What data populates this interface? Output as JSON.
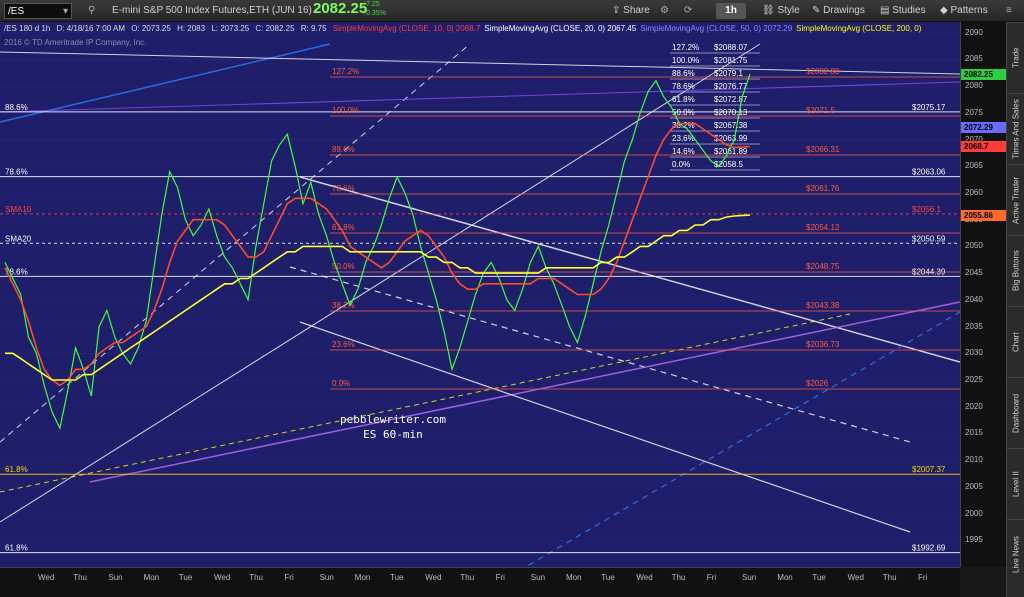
{
  "toolbar": {
    "symbol": "/ES",
    "title": "E-mini S&P 500 Index Futures,ETH (JUN 16)",
    "price": "2082.25",
    "change": "+7.25",
    "change_pct": "+0.35%",
    "share_label": "Share",
    "timeframe": "1h",
    "style_label": "Style",
    "drawings_label": "Drawings",
    "studies_label": "Studies",
    "patterns_label": "Patterns"
  },
  "ohlc": {
    "symbol": "/ES 180 d 1h",
    "date": "D: 4/18/16 7:00 AM",
    "open": "O: 2073.25",
    "high": "H: 2083",
    "low": "L: 2073.25",
    "close": "C: 2082.25",
    "range": "R: 9.75"
  },
  "studies": [
    {
      "label": "SimpleMovingAvg (CLOSE, 10, 0)",
      "value": "2068.7",
      "color": "#ff3b3b"
    },
    {
      "label": "SimpleMovingAvg (CLOSE, 20, 0)",
      "value": "2067.45",
      "color": "#ffffff"
    },
    {
      "label": "SimpleMovingAvg (CLOSE, 50, 0)",
      "value": "2072.29",
      "color": "#8a8aff"
    },
    {
      "label": "SimpleMovingAvg (CLOSE, 200, 0)",
      "value": "",
      "color": "#ffff00"
    }
  ],
  "copyright": "2016 © TD Ameritrade IP Company, Inc.",
  "watermark": {
    "line1": "pebblewriter.com",
    "line2": "ES 60-min"
  },
  "sidebar_tabs": [
    "Trade",
    "Times And Sales",
    "Active Trader",
    "Big Buttons",
    "Chart",
    "Dashboard",
    "Level II",
    "Live News"
  ],
  "price_flags": [
    {
      "value": "2082.25",
      "price": 2082.25,
      "bg": "#2ecc40",
      "fg": "#000000"
    },
    {
      "value": "2072.29",
      "price": 2072.29,
      "bg": "#6a6aff",
      "fg": "#000000"
    },
    {
      "value": "2068.7",
      "price": 2068.7,
      "bg": "#ff3b3b",
      "fg": "#000000"
    },
    {
      "value": "2055.86",
      "price": 2055.86,
      "bg": "#ff6a2a",
      "fg": "#000000"
    }
  ],
  "chart_data": {
    "type": "line",
    "title": "",
    "xlabel": "",
    "ylabel": "",
    "ylim": [
      1990,
      2092
    ],
    "yticks": [
      1995,
      2000,
      2005,
      2010,
      2015,
      2020,
      2025,
      2030,
      2035,
      2040,
      2045,
      2050,
      2055,
      2060,
      2065,
      2070,
      2075,
      2080,
      2085,
      2090
    ],
    "xticks": [
      "Wed",
      "Thu",
      "Sun",
      "Mon",
      "Tue",
      "Wed",
      "Thu",
      "Fri",
      "Sun",
      "Mon",
      "Tue",
      "Wed",
      "Thu",
      "Fri",
      "Sun",
      "Mon",
      "Tue",
      "Wed",
      "Thu",
      "Fri",
      "Sun",
      "Mon",
      "Tue",
      "Wed",
      "Thu",
      "Fri"
    ],
    "fib_levels_recent": [
      {
        "label": "127.2%",
        "value": "$2088.07"
      },
      {
        "label": "100.0%",
        "value": "$2081.75"
      },
      {
        "label": "88.6%",
        "value": "$2079.1"
      },
      {
        "label": "78.6%",
        "value": "$2076.77"
      },
      {
        "label": "61.8%",
        "value": "$2072.87"
      },
      {
        "label": "50.0%",
        "value": "$2070.13"
      },
      {
        "label": "38.2%",
        "value": "$2067.38"
      },
      {
        "label": "23.6%",
        "value": "$2063.99"
      },
      {
        "label": "14.6%",
        "value": "$2061.89"
      },
      {
        "label": "0.0%",
        "value": "$2058.5"
      }
    ],
    "fib_levels_prior": [
      {
        "label": "127.2%",
        "value": "$2082.88"
      },
      {
        "label": "100.0%",
        "value": "$2071.5"
      },
      {
        "label": "88.6%",
        "value": "$2066.31"
      },
      {
        "label": "78.6%",
        "value": "$2061.76"
      },
      {
        "label": "61.8%",
        "value": "$2054.12"
      },
      {
        "label": "50.0%",
        "value": "$2048.75"
      },
      {
        "label": "38.2%",
        "value": "$2043.38"
      },
      {
        "label": "23.6%",
        "value": "$2036.73"
      },
      {
        "label": "0.0%",
        "value": "$2026"
      }
    ],
    "horizontal_levels": [
      {
        "label": "88.6%",
        "value": "$2075.17",
        "price": 2075.17
      },
      {
        "label": "78.6%",
        "value": "$2063.06",
        "price": 2063.06
      },
      {
        "label": "SMA10",
        "value": "$2056.1",
        "price": 2056.1
      },
      {
        "label": "SMA20",
        "value": "$2050.59",
        "price": 2050.59
      },
      {
        "label": "78.6%",
        "value": "$2044.39",
        "price": 2044.39
      },
      {
        "label": "61.8%",
        "value": "$2007.37",
        "price": 2007.37
      },
      {
        "label": "61.8%",
        "value": "$1992.69",
        "price": 1992.69
      }
    ],
    "series": [
      {
        "name": "/ES",
        "values": [
          2047,
          2044,
          2041,
          2033,
          2030,
          2024,
          2019,
          2016,
          2023,
          2031,
          2027,
          2022,
          2035,
          2038,
          2033,
          2030,
          2028,
          2031,
          2036,
          2046,
          2056,
          2064,
          2061,
          2055,
          2052,
          2054,
          2057,
          2052,
          2048,
          2046,
          2043,
          2040,
          2050,
          2058,
          2066,
          2069,
          2071,
          2065,
          2058,
          2062,
          2056,
          2052,
          2047,
          2043,
          2039,
          2042,
          2047,
          2050,
          2054,
          2059,
          2063,
          2060,
          2056,
          2050,
          2045,
          2040,
          2034,
          2027,
          2031,
          2036,
          2041,
          2045,
          2047,
          2044,
          2040,
          2038,
          2042,
          2047,
          2050,
          2046,
          2043,
          2039,
          2035,
          2032,
          2037,
          2043,
          2049,
          2054,
          2060,
          2066,
          2070,
          2075,
          2079,
          2081,
          2078,
          2076,
          2073,
          2072,
          2070,
          2068,
          2066,
          2065,
          2067,
          2070,
          2078,
          2082.25
        ]
      },
      {
        "name": "SMA 10",
        "values": [
          2046,
          2043,
          2040,
          2036,
          2031,
          2027,
          2025,
          2024,
          2025,
          2027,
          2027,
          2028,
          2030,
          2031,
          2032,
          2032,
          2033,
          2034,
          2035,
          2038,
          2042,
          2047,
          2051,
          2053,
          2055,
          2055,
          2055,
          2055,
          2054,
          2052,
          2050,
          2048,
          2048,
          2049,
          2052,
          2055,
          2058,
          2059,
          2059,
          2059,
          2058,
          2057,
          2055,
          2053,
          2050,
          2049,
          2048,
          2047,
          2046,
          2047,
          2049,
          2051,
          2052,
          2053,
          2052,
          2050,
          2048,
          2045,
          2043,
          2042,
          2042,
          2043,
          2043,
          2043,
          2043,
          2043,
          2043,
          2043,
          2044,
          2044,
          2044,
          2043,
          2042,
          2041,
          2041,
          2041,
          2042,
          2044,
          2047,
          2051,
          2055,
          2059,
          2063,
          2067,
          2070,
          2072,
          2073,
          2073,
          2073,
          2072,
          2071,
          2070,
          2069,
          2068.5,
          2068.6,
          2068.7
        ]
      },
      {
        "name": "SMA 50",
        "values": [
          2030,
          2030,
          2029,
          2028,
          2027,
          2026,
          2025,
          2025,
          2025,
          2025,
          2026,
          2026,
          2027,
          2028,
          2029,
          2030,
          2031,
          2032,
          2033,
          2034,
          2035,
          2036,
          2037,
          2038,
          2039,
          2040,
          2041,
          2042,
          2043,
          2043,
          2044,
          2044,
          2045,
          2046,
          2047,
          2048,
          2049,
          2049,
          2050,
          2050,
          2050,
          2050,
          2050,
          2050,
          2049,
          2049,
          2049,
          2049,
          2049,
          2049,
          2049,
          2049,
          2049,
          2049,
          2048,
          2048,
          2047,
          2047,
          2046,
          2046,
          2045,
          2045,
          2045,
          2045,
          2045,
          2045,
          2045,
          2045,
          2045,
          2046,
          2046,
          2046,
          2046,
          2046,
          2046,
          2046,
          2047,
          2047,
          2048,
          2048,
          2049,
          2050,
          2050,
          2051,
          2052,
          2052,
          2053,
          2053,
          2054,
          2054,
          2055,
          2055,
          2055.5,
          2055.7,
          2055.8,
          2055.86
        ]
      }
    ]
  }
}
